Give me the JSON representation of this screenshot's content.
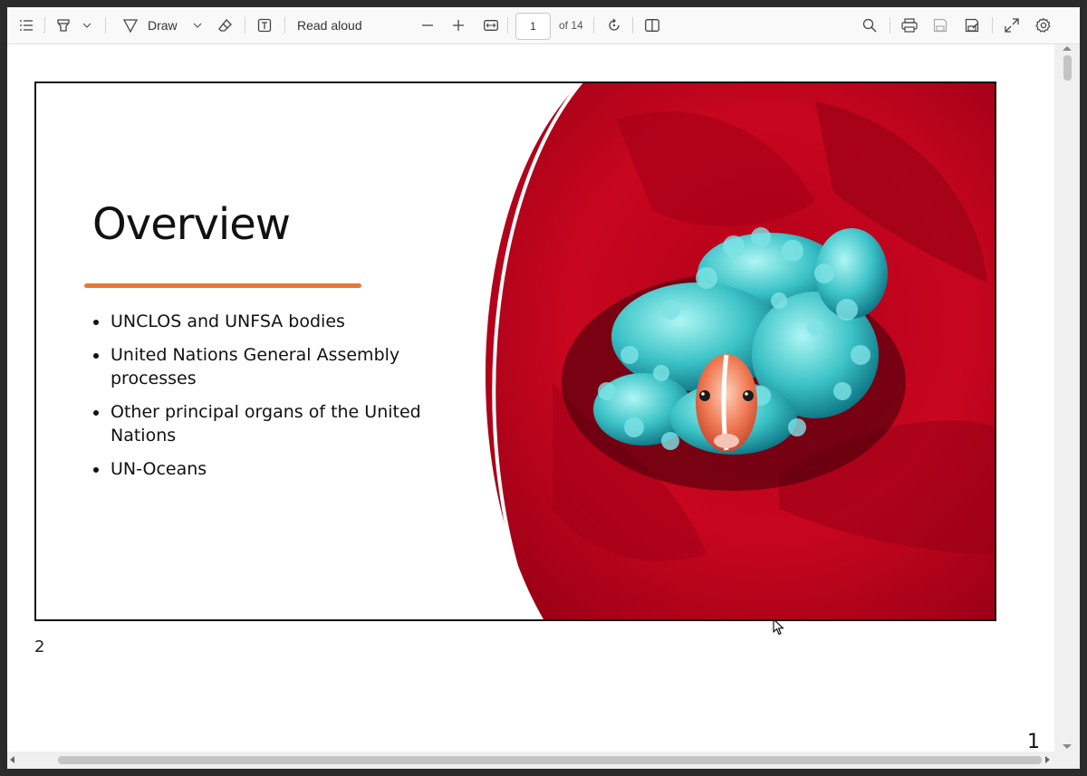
{
  "toolbar": {
    "draw_label": "Draw",
    "read_aloud_label": "Read aloud",
    "current_page": "1",
    "page_count_label": "of 14",
    "icons": [
      "contents-icon",
      "highlight-icon",
      "chevron-down-icon",
      "draw-icon",
      "chevron-down-icon",
      "eraser-icon",
      "text-box-icon",
      "zoom-out-icon",
      "zoom-in-icon",
      "fit-width-icon",
      "rotate-icon",
      "page-view-icon",
      "search-icon",
      "print-icon",
      "save-icon",
      "save-as-icon",
      "fullscreen-icon",
      "settings-icon"
    ]
  },
  "slide": {
    "title": "Overview",
    "accent_color": "#e6773a",
    "bullets": [
      "UNCLOS and UNFSA bodies",
      "United Nations General Assembly processes",
      "Other principal organs of the United Nations",
      "UN-Oceans"
    ],
    "image_description_icon": "clownfish-anemone-photo"
  },
  "page_labels": {
    "slide_number": "2",
    "pdf_page_number": "1"
  }
}
